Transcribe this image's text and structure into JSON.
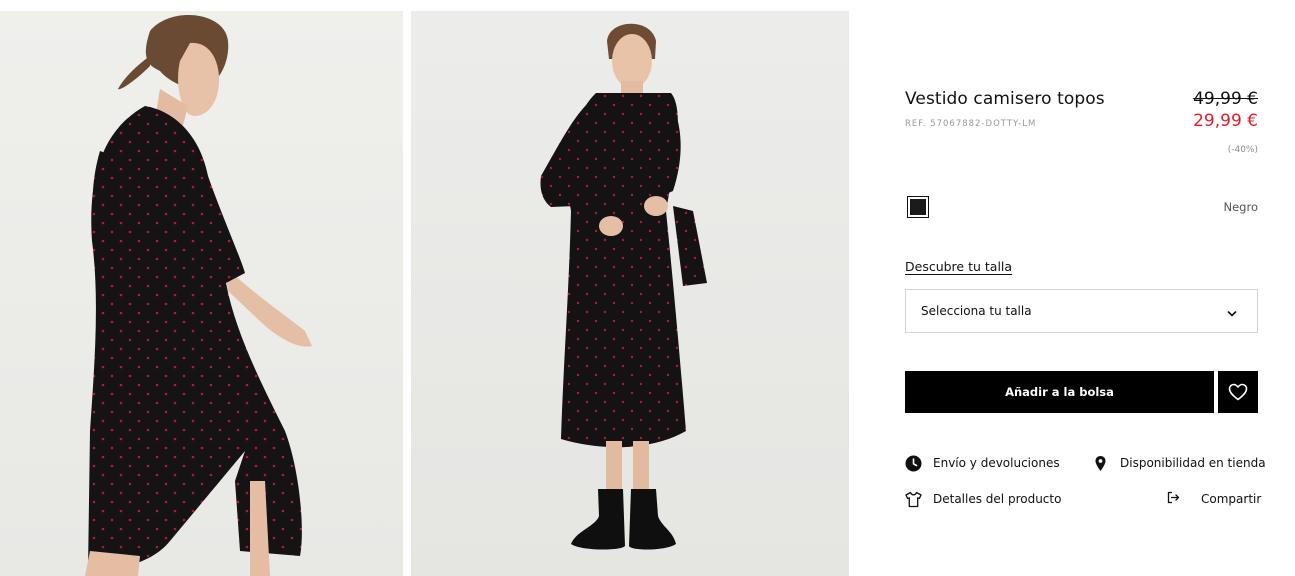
{
  "product": {
    "title": "Vestido camisero topos",
    "ref": "REF. 57067882-DOTTY-LM",
    "price_original": "49,99 €",
    "price_sale": "29,99 €",
    "discount": "(-40%)"
  },
  "color": {
    "selected_name": "Negro",
    "swatch_hex": "#1b1b1b"
  },
  "size": {
    "guide_link": "Descubre tu talla",
    "select_placeholder": "Selecciona tu talla"
  },
  "actions": {
    "add_to_bag": "Añadir a la bolsa"
  },
  "links": {
    "shipping": "Envío y devoluciones",
    "store_availability": "Disponibilidad en tienda",
    "product_details": "Detalles del producto",
    "share": "Compartir"
  },
  "icons": {
    "shipping": "clock-icon",
    "store": "location-pin-icon",
    "details": "shirt-icon",
    "share": "share-icon",
    "wishlist": "heart-icon",
    "select": "chevron-down-icon"
  },
  "colors": {
    "sale_price": "#e31c2d",
    "button_bg": "#000000"
  }
}
